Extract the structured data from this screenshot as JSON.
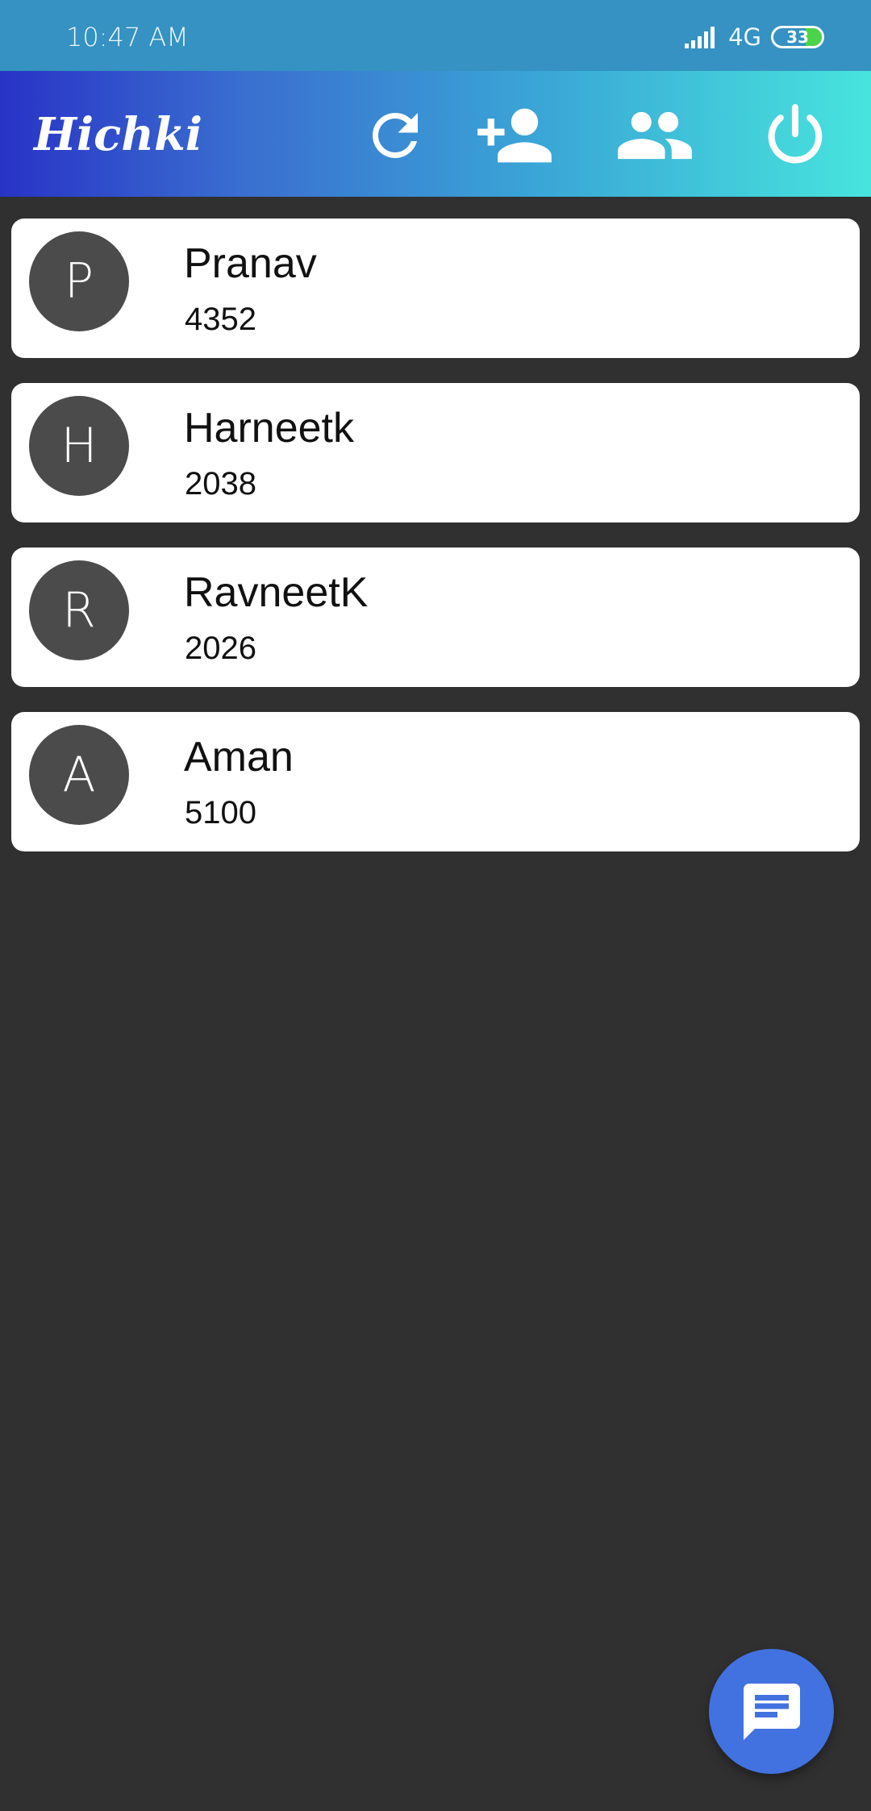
{
  "status_bar": {
    "time": "10:47 AM",
    "network": "4G",
    "battery": "33",
    "battery_level": 0.33
  },
  "app_bar": {
    "logo": "Hichki",
    "actions": [
      {
        "icon": "refresh-icon"
      },
      {
        "icon": "add-person-icon"
      },
      {
        "icon": "group-icon"
      },
      {
        "icon": "power-icon"
      }
    ]
  },
  "contacts": [
    {
      "initial": "P",
      "name": "Pranav",
      "code": "4352"
    },
    {
      "initial": "H",
      "name": "Harneetk",
      "code": "2038"
    },
    {
      "initial": "R",
      "name": "RavneetK",
      "code": "2026"
    },
    {
      "initial": "A",
      "name": "Aman",
      "code": "5100"
    }
  ],
  "fab": {
    "icon": "message-icon"
  },
  "colors": {
    "background": "#303030",
    "status_bar": "#3592c2",
    "avatar": "#4b4b4b",
    "fab": "#4272e0",
    "gradient_start": "#2833c6",
    "gradient_end": "#47e4dd"
  }
}
